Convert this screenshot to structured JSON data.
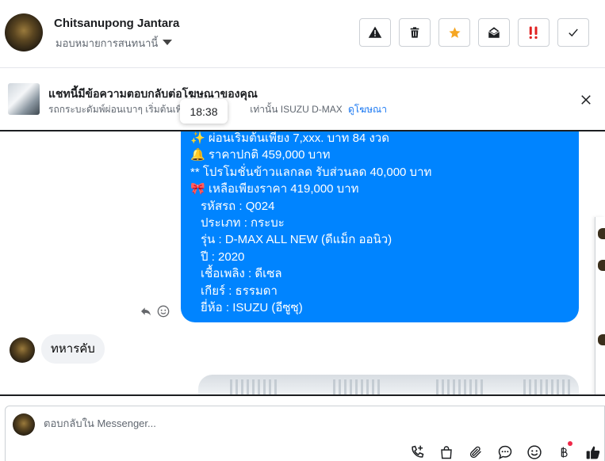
{
  "header": {
    "name": "Chitsanupong Jantara",
    "assign_label": "มอบหมายการสนทนานี้",
    "actions": [
      {
        "icon": "warning-icon"
      },
      {
        "icon": "trash-icon"
      },
      {
        "icon": "star-icon",
        "color": "#f5a623"
      },
      {
        "icon": "envelope-open-icon"
      },
      {
        "icon": "follow-up-icon",
        "color": "#e02020"
      },
      {
        "icon": "check-icon"
      }
    ]
  },
  "ad_banner": {
    "title": "แชทนี้มีข้อความตอบกลับต่อโฆษณาของคุณ",
    "description": "รถกระบะดัมพ์ผ่อนเบาๆ เริ่มต้นเพียง",
    "description_tail": "เท่านั้น ISUZU D-MAX A...",
    "link": "ดูโฆษณา"
  },
  "tooltip": {
    "time": "18:38"
  },
  "conversation": {
    "outgoing_lines": [
      "✨  ผ่อนเริ่มต้นเพียง 7,xxx. บาท 84 งวด",
      "🔔   ราคาปกติ 459,000 บาท",
      "** โปรโมชั่นข้าวแลกลด รับส่วนลด 40,000 บาท",
      "🎀  เหลือเพียงราคา 419,000 บาท",
      "รหัสรถ : Q024",
      "ประเภท : กระบะ",
      "รุ่น : D-MAX ALL NEW (ดีแม็ก ออนิว)",
      "ปี : 2020",
      "เชื้อเพลิง : ดีเซล",
      "เกียร์ : ธรรมดา",
      "ยี่ห้อ : ISUZU (อีซูซุ)"
    ],
    "incoming_text": "ทหารคับ"
  },
  "composer": {
    "placeholder": "ตอบกลับใน Messenger...",
    "tools": [
      "add-contact-icon",
      "shopping-bag-icon",
      "paperclip-icon",
      "chat-bubble-icon",
      "emoji-icon",
      "baht-icon",
      "thumbs-up-icon"
    ]
  },
  "colors": {
    "accent": "#0084ff",
    "link": "#1877f2",
    "star": "#f5a623",
    "urgent": "#e02020",
    "badge": "#f02849"
  }
}
